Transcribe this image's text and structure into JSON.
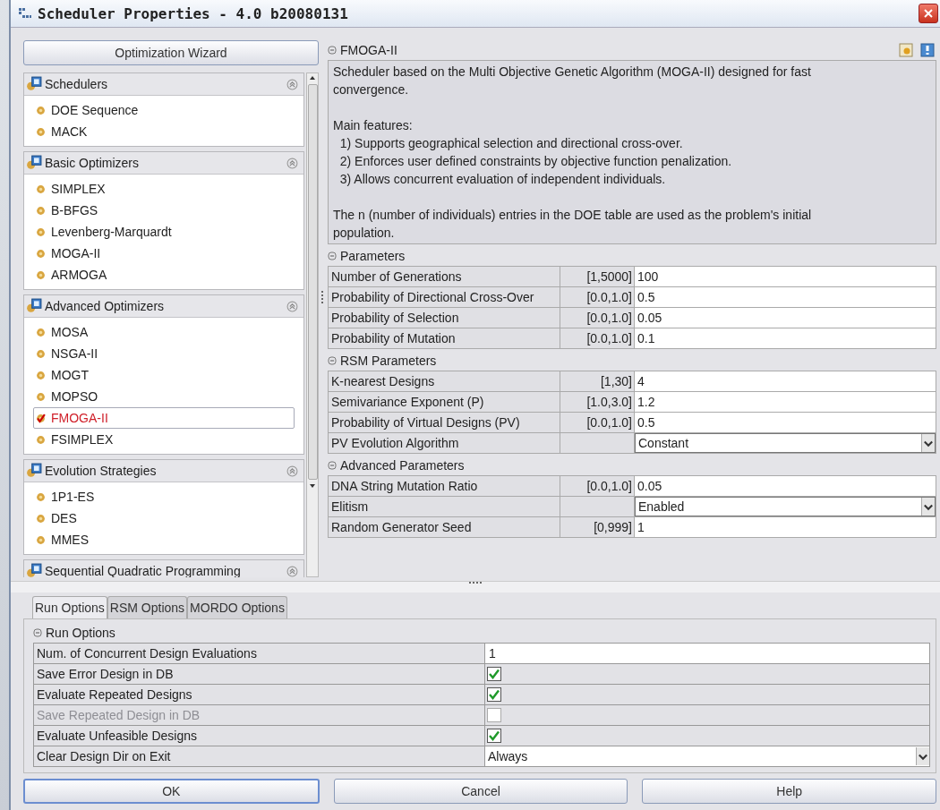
{
  "window": {
    "title": "Scheduler Properties - 4.0 b20080131"
  },
  "wizard_button": "Optimization Wizard",
  "scheduler_groups": [
    {
      "title": "Schedulers",
      "items": [
        {
          "label": "DOE Sequence",
          "selected": false
        },
        {
          "label": "MACK",
          "selected": false
        }
      ]
    },
    {
      "title": "Basic Optimizers",
      "items": [
        {
          "label": "SIMPLEX",
          "selected": false
        },
        {
          "label": "B-BFGS",
          "selected": false
        },
        {
          "label": "Levenberg-Marquardt",
          "selected": false
        },
        {
          "label": "MOGA-II",
          "selected": false
        },
        {
          "label": "ARMOGA",
          "selected": false
        }
      ]
    },
    {
      "title": "Advanced Optimizers",
      "items": [
        {
          "label": "MOSA",
          "selected": false
        },
        {
          "label": "NSGA-II",
          "selected": false
        },
        {
          "label": "MOGT",
          "selected": false
        },
        {
          "label": "MOPSO",
          "selected": false
        },
        {
          "label": "FMOGA-II",
          "selected": true
        },
        {
          "label": "FSIMPLEX",
          "selected": false
        }
      ]
    },
    {
      "title": "Evolution Strategies",
      "items": [
        {
          "label": "1P1-ES",
          "selected": false
        },
        {
          "label": "DES",
          "selected": false
        },
        {
          "label": "MMES",
          "selected": false
        }
      ]
    },
    {
      "title": "Sequential Quadratic Programming"
    }
  ],
  "description": {
    "title": "FMOGA-II",
    "paragraphs": [
      "Scheduler based on the Multi Objective Genetic Algorithm (MOGA-II) designed for fast convergence.",
      "Main features:\n  1) Supports geographical selection and directional cross-over.\n  2) Enforces user defined constraints by objective function penalization.\n  3) Allows concurrent evaluation of independent individuals.",
      "The n (number of individuals) entries in the DOE table are used as the problem's initial population."
    ]
  },
  "parameter_sections": [
    {
      "title": "Parameters",
      "rows": [
        {
          "label": "Number of Generations",
          "range": "[1,5000]",
          "value": "100",
          "kind": "text"
        },
        {
          "label": "Probability of Directional Cross-Over",
          "range": "[0.0,1.0]",
          "value": "0.5",
          "kind": "text"
        },
        {
          "label": "Probability of Selection",
          "range": "[0.0,1.0]",
          "value": "0.05",
          "kind": "text"
        },
        {
          "label": "Probability of Mutation",
          "range": "[0.0,1.0]",
          "value": "0.1",
          "kind": "text"
        }
      ]
    },
    {
      "title": "RSM Parameters",
      "rows": [
        {
          "label": "K-nearest Designs",
          "range": "[1,30]",
          "value": "4",
          "kind": "text"
        },
        {
          "label": "Semivariance Exponent (P)",
          "range": "[1.0,3.0]",
          "value": "1.2",
          "kind": "text"
        },
        {
          "label": "Probability of Virtual Designs (PV)",
          "range": "[0.0,1.0]",
          "value": "0.5",
          "kind": "text"
        },
        {
          "label": "PV Evolution Algorithm",
          "value": "Constant",
          "kind": "select"
        }
      ]
    },
    {
      "title": "Advanced Parameters",
      "rows": [
        {
          "label": "DNA String Mutation Ratio",
          "range": "[0.0,1.0]",
          "value": "0.05",
          "kind": "text"
        },
        {
          "label": "Elitism",
          "value": "Enabled",
          "kind": "select"
        },
        {
          "label": "Random Generator Seed",
          "range": "[0,999]",
          "value": "1",
          "kind": "text"
        }
      ]
    }
  ],
  "tabs": [
    {
      "label": "Run Options",
      "selected": true
    },
    {
      "label": "RSM Options",
      "selected": false
    },
    {
      "label": "MORDO Options",
      "selected": false
    }
  ],
  "run_options": {
    "title": "Run Options",
    "rows": [
      {
        "label": "Num. of Concurrent Design Evaluations",
        "kind": "text",
        "value": "1",
        "disabled": false
      },
      {
        "label": "Save Error Design in DB",
        "kind": "checkbox",
        "checked": true,
        "disabled": false
      },
      {
        "label": "Evaluate Repeated Designs",
        "kind": "checkbox",
        "checked": true,
        "disabled": false
      },
      {
        "label": "Save Repeated Design in DB",
        "kind": "checkbox",
        "checked": false,
        "disabled": true
      },
      {
        "label": "Evaluate Unfeasible Designs",
        "kind": "checkbox",
        "checked": true,
        "disabled": false
      },
      {
        "label": "Clear Design Dir on Exit",
        "kind": "select",
        "value": "Always",
        "disabled": false
      }
    ]
  },
  "buttons": [
    "OK",
    "Cancel",
    "Help"
  ]
}
